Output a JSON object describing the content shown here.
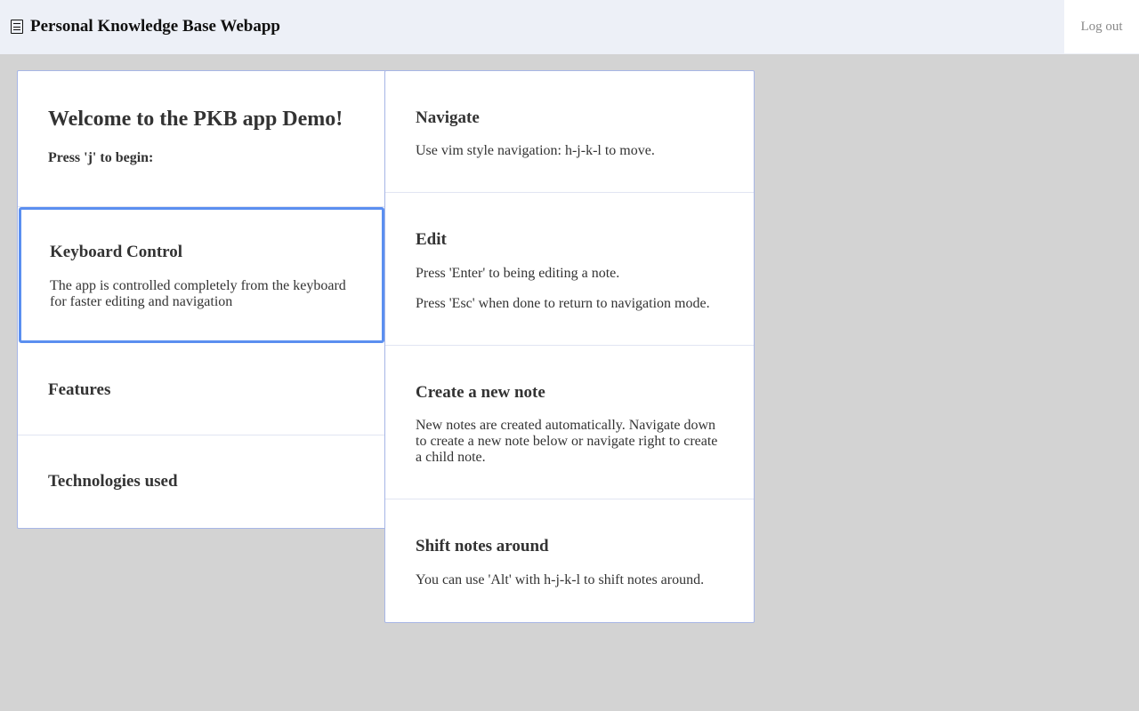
{
  "header": {
    "title": "Personal Knowledge Base Webapp",
    "menu_icon": "document-menu-icon",
    "logout_label": "Log out"
  },
  "colors": {
    "background": "#d3d3d3",
    "header_bg": "#edf0f7",
    "card_border": "#a7b6e6",
    "selected_border": "#5b8ff0"
  },
  "left_column": {
    "welcome": {
      "title": "Welcome to the PKB app Demo!",
      "subtitle": "Press 'j' to begin:"
    },
    "keyboard": {
      "title": "Keyboard Control",
      "body": "The app is controlled completely from the keyboard for faster editing and navigation"
    },
    "features": {
      "title": "Features"
    },
    "technologies": {
      "title": "Technologies used"
    }
  },
  "right_column": {
    "navigate": {
      "title": "Navigate",
      "body": "Use vim style navigation: h-j-k-l to move."
    },
    "edit": {
      "title": "Edit",
      "body_1": "Press 'Enter' to being editing a note.",
      "body_2": "Press 'Esc' when done to return to navigation mode."
    },
    "create": {
      "title": "Create a new note",
      "body": "New notes are created automatically. Navigate down to create a new note below or navigate right to create a child note."
    },
    "shift": {
      "title": "Shift notes around",
      "body": "You can use 'Alt' with h-j-k-l to shift notes around."
    }
  }
}
